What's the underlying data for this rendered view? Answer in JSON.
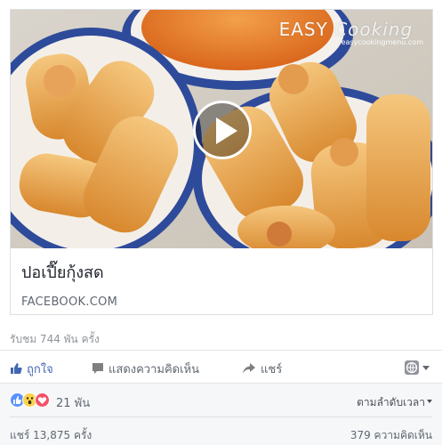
{
  "card": {
    "title": "ปอเปี๊ยกุ้งสด",
    "source": "FACEBOOK.COM",
    "watermark_brand_a": "EASY",
    "watermark_brand_b": "Cooking",
    "watermark_url": "easycookingmenu.com"
  },
  "stats": {
    "views": "รับชม 744 พัน ครั้ง"
  },
  "actions": {
    "like_label": "ถูกใจ",
    "comment_label": "แสดงความคิดเห็น",
    "share_label": "แชร์"
  },
  "reactions": {
    "count": "21 พัน",
    "types": [
      "like-icon",
      "wow-icon",
      "love-icon"
    ],
    "sort_label": "ตามลำดับเวลา"
  },
  "footer": {
    "shares": "แชร์ 13,875 ครั้ง",
    "comments": "379 ความคิดเห็น"
  },
  "colors": {
    "like_blue": "#4267b2",
    "reaction_like": "#5890ff",
    "reaction_wow": "#fcd34c",
    "reaction_love": "#f25268"
  }
}
